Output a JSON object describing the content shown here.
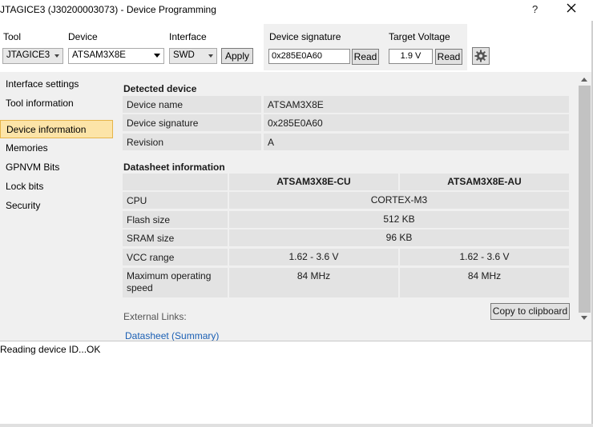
{
  "window": {
    "title": "JTAGICE3 (J30200003073) - Device Programming",
    "help_label": "?",
    "close_icon": "close-icon"
  },
  "toolbar": {
    "tool_label": "Tool",
    "tool_value": "JTAGICE3",
    "device_label": "Device",
    "device_value": "ATSAM3X8E",
    "interface_label": "Interface",
    "interface_value": "SWD",
    "apply_label": "Apply",
    "signature_label": "Device signature",
    "signature_value": "0x285E0A60",
    "read_label": "Read",
    "voltage_label": "Target Voltage",
    "voltage_value": "1.9 V",
    "voltage_read_label": "Read",
    "settings_icon": "gear-icon"
  },
  "nav": {
    "items": [
      {
        "label": "Interface settings"
      },
      {
        "label": "Tool information"
      },
      {
        "label": "Device information"
      },
      {
        "label": "Memories"
      },
      {
        "label": "GPNVM Bits"
      },
      {
        "label": "Lock bits"
      },
      {
        "label": "Security"
      }
    ],
    "selected": "Device information"
  },
  "detected": {
    "title": "Detected device",
    "rows": [
      {
        "label": "Device name",
        "value": "ATSAM3X8E"
      },
      {
        "label": "Device signature",
        "value": "0x285E0A60"
      },
      {
        "label": "Revision",
        "value": "A"
      }
    ]
  },
  "datasheet": {
    "title": "Datasheet information",
    "columns": [
      "ATSAM3X8E-CU",
      "ATSAM3X8E-AU"
    ],
    "rows": [
      {
        "label": "CPU",
        "merged": "CORTEX-M3"
      },
      {
        "label": "Flash size",
        "merged": "512 KB"
      },
      {
        "label": "SRAM size",
        "merged": "96 KB"
      },
      {
        "label": "VCC range",
        "cu": "1.62 - 3.6 V",
        "au": "1.62 - 3.6 V"
      },
      {
        "label": "Maximum operating speed",
        "cu": "84 MHz",
        "au": "84 MHz"
      }
    ]
  },
  "links": {
    "title": "External Links:",
    "datasheet_link": "Datasheet (Summary)",
    "copy_label": "Copy to clipboard"
  },
  "log": {
    "text": "Reading device ID...OK"
  }
}
